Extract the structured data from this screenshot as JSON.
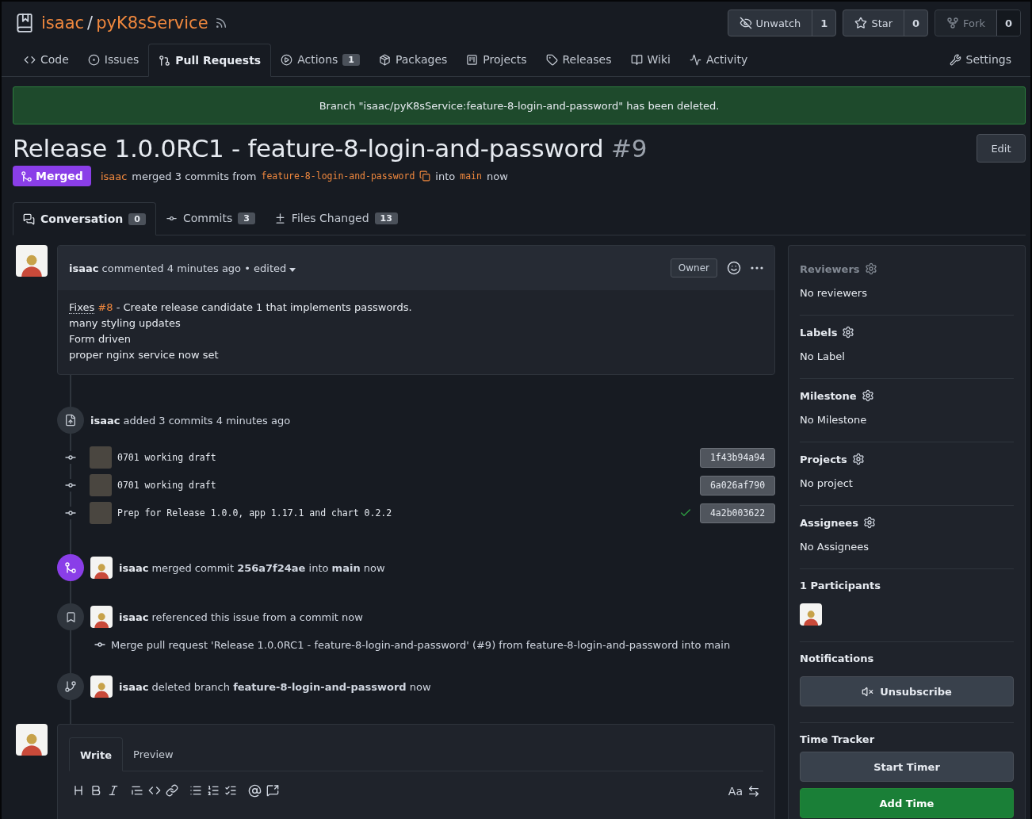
{
  "repo": {
    "owner": "isaac",
    "separator": "/",
    "name": "pyK8sService"
  },
  "repo_buttons": [
    {
      "label": "Unwatch",
      "count": "1",
      "disabled": false
    },
    {
      "label": "Star",
      "count": "0",
      "disabled": false
    },
    {
      "label": "Fork",
      "count": "0",
      "disabled": true
    }
  ],
  "nav_tabs": [
    {
      "label": "Code",
      "selected": false
    },
    {
      "label": "Issues",
      "selected": false
    },
    {
      "label": "Pull Requests",
      "selected": true
    },
    {
      "label": "Actions",
      "count": "1",
      "selected": false
    },
    {
      "label": "Packages",
      "selected": false
    },
    {
      "label": "Projects",
      "selected": false
    },
    {
      "label": "Releases",
      "selected": false
    },
    {
      "label": "Wiki",
      "selected": false
    },
    {
      "label": "Activity",
      "selected": false
    }
  ],
  "settings_tab": {
    "label": "Settings",
    "selected": false
  },
  "flash": "Branch \"isaac/pyK8sService:feature-8-login-and-password\" has been deleted.",
  "title": {
    "text": "Release 1.0.0RC1 - feature-8-login-and-password",
    "number": "#9"
  },
  "edit_button": "Edit",
  "status": {
    "badge": "Merged",
    "author": "isaac",
    "text": "merged 3 commits from",
    "branch": "feature-8-login-and-password",
    "into": "into",
    "target": "main",
    "time": "now"
  },
  "pr_tabs": [
    {
      "label": "Conversation",
      "count": "0",
      "selected": true
    },
    {
      "label": "Commits",
      "count": "3",
      "selected": false
    },
    {
      "label": "Files Changed",
      "count": "13",
      "selected": false
    }
  ],
  "comment": {
    "author": "isaac",
    "meta": "commented 4 minutes ago",
    "separator": "•",
    "edited": "edited",
    "role": "Owner",
    "first_line": {
      "keyword": "Fixes",
      "issue": "#8",
      "text": "- Create release candidate 1 that implements passwords."
    },
    "lines": [
      "many styling updates",
      "Form driven",
      "proper nginx service now set"
    ]
  },
  "timeline": [
    {
      "kind": "commits",
      "author": "isaac",
      "text": "added 3 commits 4 minutes ago",
      "commits": [
        {
          "message": "0701 working draft",
          "sha": "1f43b94a94",
          "verified": false
        },
        {
          "message": "0701 working draft",
          "sha": "6a026af790",
          "verified": false
        },
        {
          "message": "Prep for Release 1.0.0, app 1.17.1 and chart 0.2.2",
          "sha": "4a2b003622",
          "verified": true
        }
      ]
    },
    {
      "kind": "merge",
      "author": "isaac",
      "text": "merged commit **256a7f24ae** into **main** now"
    },
    {
      "kind": "reference",
      "author": "isaac",
      "text": "referenced this issue from a commit now",
      "commit_message": "Merge pull request 'Release 1.0.0RC1 - feature-8-login-and-password' (#9) from feature-8-login-and-password into main"
    },
    {
      "kind": "branch_deleted",
      "author": "isaac",
      "text": "deleted branch **feature-8-login-and-password** now"
    }
  ],
  "editor": {
    "tabs": [
      {
        "label": "Write",
        "selected": true
      },
      {
        "label": "Preview",
        "selected": false
      }
    ],
    "text_style": "Aa"
  },
  "sidebar": {
    "sections": [
      {
        "title": "Reviewers",
        "value": "No reviewers",
        "disabled": true
      },
      {
        "title": "Labels",
        "value": "No Label",
        "disabled": false
      },
      {
        "title": "Milestone",
        "value": "No Milestone",
        "disabled": false
      },
      {
        "title": "Projects",
        "value": "No project",
        "disabled": false
      },
      {
        "title": "Assignees",
        "value": "No Assignees",
        "disabled": false
      }
    ],
    "participants": "1 Participants",
    "notifications": {
      "title": "Notifications",
      "button": "Unsubscribe"
    },
    "time_tracker": {
      "title": "Time Tracker",
      "buttons": [
        {
          "label": "Start Timer",
          "kind": "secondary"
        },
        {
          "label": "Add Time",
          "kind": "primary"
        }
      ]
    }
  }
}
